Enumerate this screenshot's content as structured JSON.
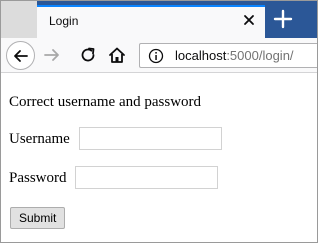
{
  "browser": {
    "tab_title": "Login",
    "url_host": "localhost",
    "url_rest": ":5000/login/",
    "accent_color": "#0a84ff",
    "tabstrip_color": "#2b5797",
    "icons": [
      "close-icon",
      "plus-icon",
      "back-arrow-icon",
      "forward-arrow-icon",
      "reload-icon",
      "home-icon",
      "info-icon"
    ]
  },
  "page": {
    "message": "Correct username and password",
    "username_label": "Username",
    "username_value": "",
    "password_label": "Password",
    "password_value": "",
    "submit_label": "Submit"
  }
}
